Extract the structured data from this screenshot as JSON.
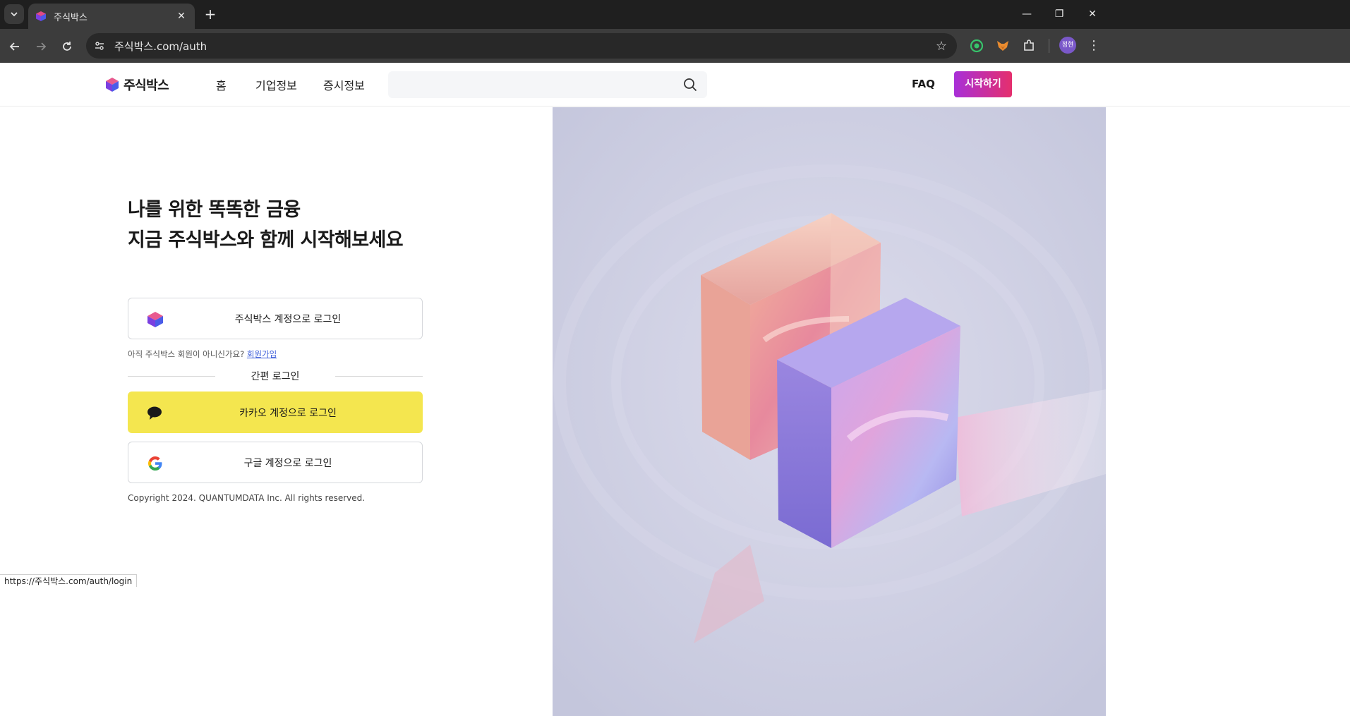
{
  "browser": {
    "tab_title": "주식박스",
    "url": "주식박스.com/auth",
    "profile_initials": "정현",
    "status_url": "https://주식박스.com/auth/login"
  },
  "header": {
    "logo_text": "주식박스",
    "nav": [
      {
        "label": "홈"
      },
      {
        "label": "기업정보"
      },
      {
        "label": "증시정보"
      }
    ],
    "search": {
      "placeholder": ""
    },
    "faq_label": "FAQ",
    "start_label": "시작하기"
  },
  "main": {
    "headline_line1": "나를 위한 똑똑한 금융",
    "headline_line2": "지금 주식박스와 함께 시작해보세요",
    "account_login_label": "주식박스 계정으로 로그인",
    "signup_prompt": "아직 주식박스 회원이 아니신가요?",
    "signup_link": "회원가입",
    "easy_login_label": "간편 로그인",
    "kakao_login_label": "카카오 계정으로 로그인",
    "google_login_label": "구글 계정으로 로그인",
    "copyright": "Copyright 2024. QUANTUMDATA Inc. All rights reserved."
  },
  "colors": {
    "kakao_yellow": "#f4e64f",
    "start_gradient_from": "#a82fd8",
    "start_gradient_to": "#e52f6d",
    "hero_bg": "#c9cbe0"
  },
  "icons": {
    "logo": "cube-logo-icon",
    "search": "search-icon",
    "kakao": "speech-bubble-icon",
    "google": "google-g-icon"
  }
}
